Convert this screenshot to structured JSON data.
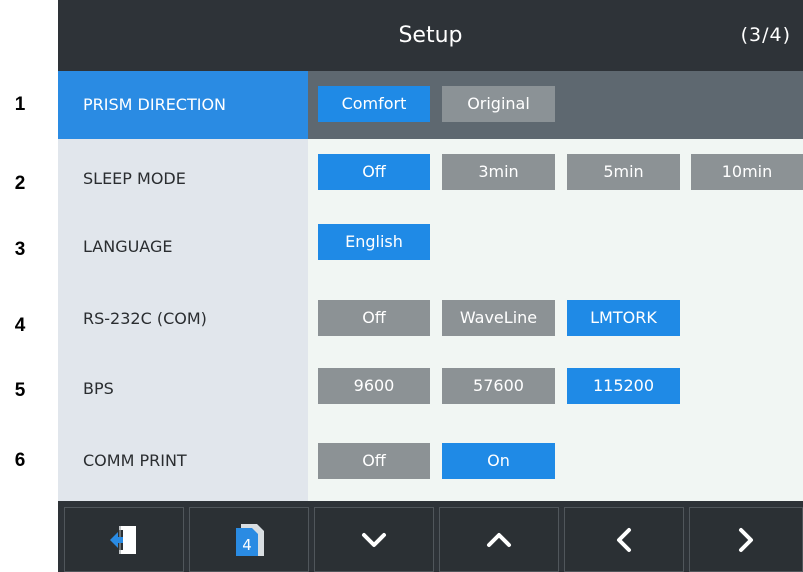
{
  "row_numbers": [
    "1",
    "2",
    "3",
    "4",
    "5",
    "6"
  ],
  "header": {
    "title": "Setup",
    "page": "(3/4)"
  },
  "rows": [
    {
      "label": "PRISM DIRECTION",
      "options": [
        "Comfort",
        "Original"
      ]
    },
    {
      "label": "SLEEP MODE",
      "options": [
        "Off",
        "3min",
        "5min",
        "10min"
      ]
    },
    {
      "label": "LANGUAGE",
      "options": [
        "English"
      ]
    },
    {
      "label": "RS-232C (COM)",
      "options": [
        "Off",
        "WaveLine",
        "LMTORK"
      ]
    },
    {
      "label": "BPS",
      "options": [
        "9600",
        "57600",
        "115200"
      ]
    },
    {
      "label": "COMM PRINT",
      "options": [
        "Off",
        "On"
      ]
    }
  ],
  "selected": {
    "prism_direction": "Comfort",
    "sleep_mode": "Off",
    "language": "English",
    "rs232c": "LMTORK",
    "bps": "115200",
    "comm_print": "On"
  },
  "toolbar": {
    "buttons": [
      "exit-icon",
      "page-number-icon",
      "chevron-down-icon",
      "chevron-up-icon",
      "chevron-left-icon",
      "chevron-right-icon"
    ],
    "page_badge": "4"
  },
  "colors": {
    "selected": "#1f8ae6",
    "unselected": "#8b9296",
    "header": "#2e3338",
    "label_column": "#e1e6ec",
    "content_background": "#f1f6f3"
  }
}
